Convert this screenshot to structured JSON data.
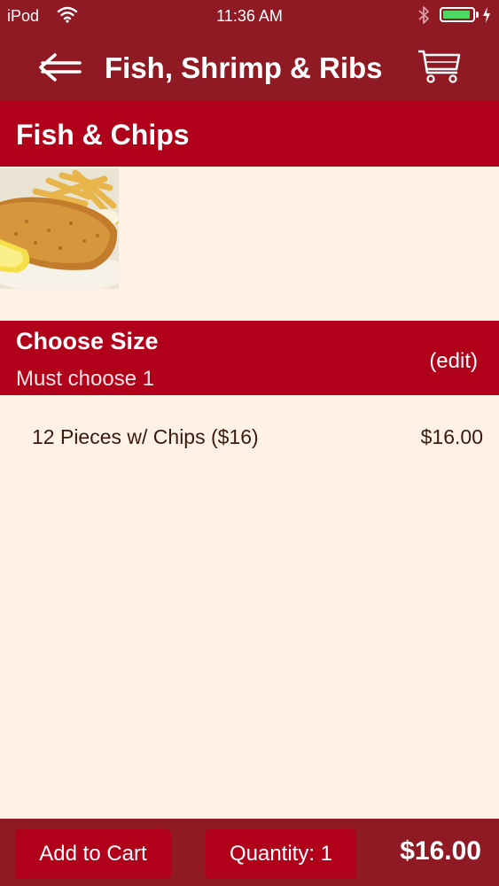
{
  "status_bar": {
    "carrier": "iPod",
    "time": "11:36 AM",
    "battery_level": 0.95,
    "battery_color": "#4cd964"
  },
  "header": {
    "title": "Fish, Shrimp & Ribs",
    "back_icon": "back-arrow-icon",
    "cart_icon": "shopping-cart-icon"
  },
  "item": {
    "title": "Fish & Chips",
    "image": "fish-and-chips-photo"
  },
  "size_section": {
    "title": "Choose Size",
    "subtitle": "Must choose 1",
    "edit_label": "(edit)",
    "options": [
      {
        "label": "12 Pieces w/ Chips ($16)",
        "price": "$16.00"
      }
    ]
  },
  "footer": {
    "add_to_cart_label": "Add to Cart",
    "quantity_label": "Quantity: 1",
    "total": "$16.00"
  },
  "colors": {
    "header_bg": "#8f1a23",
    "accent_red": "#b0001a",
    "page_bg": "#fdf2e4"
  }
}
